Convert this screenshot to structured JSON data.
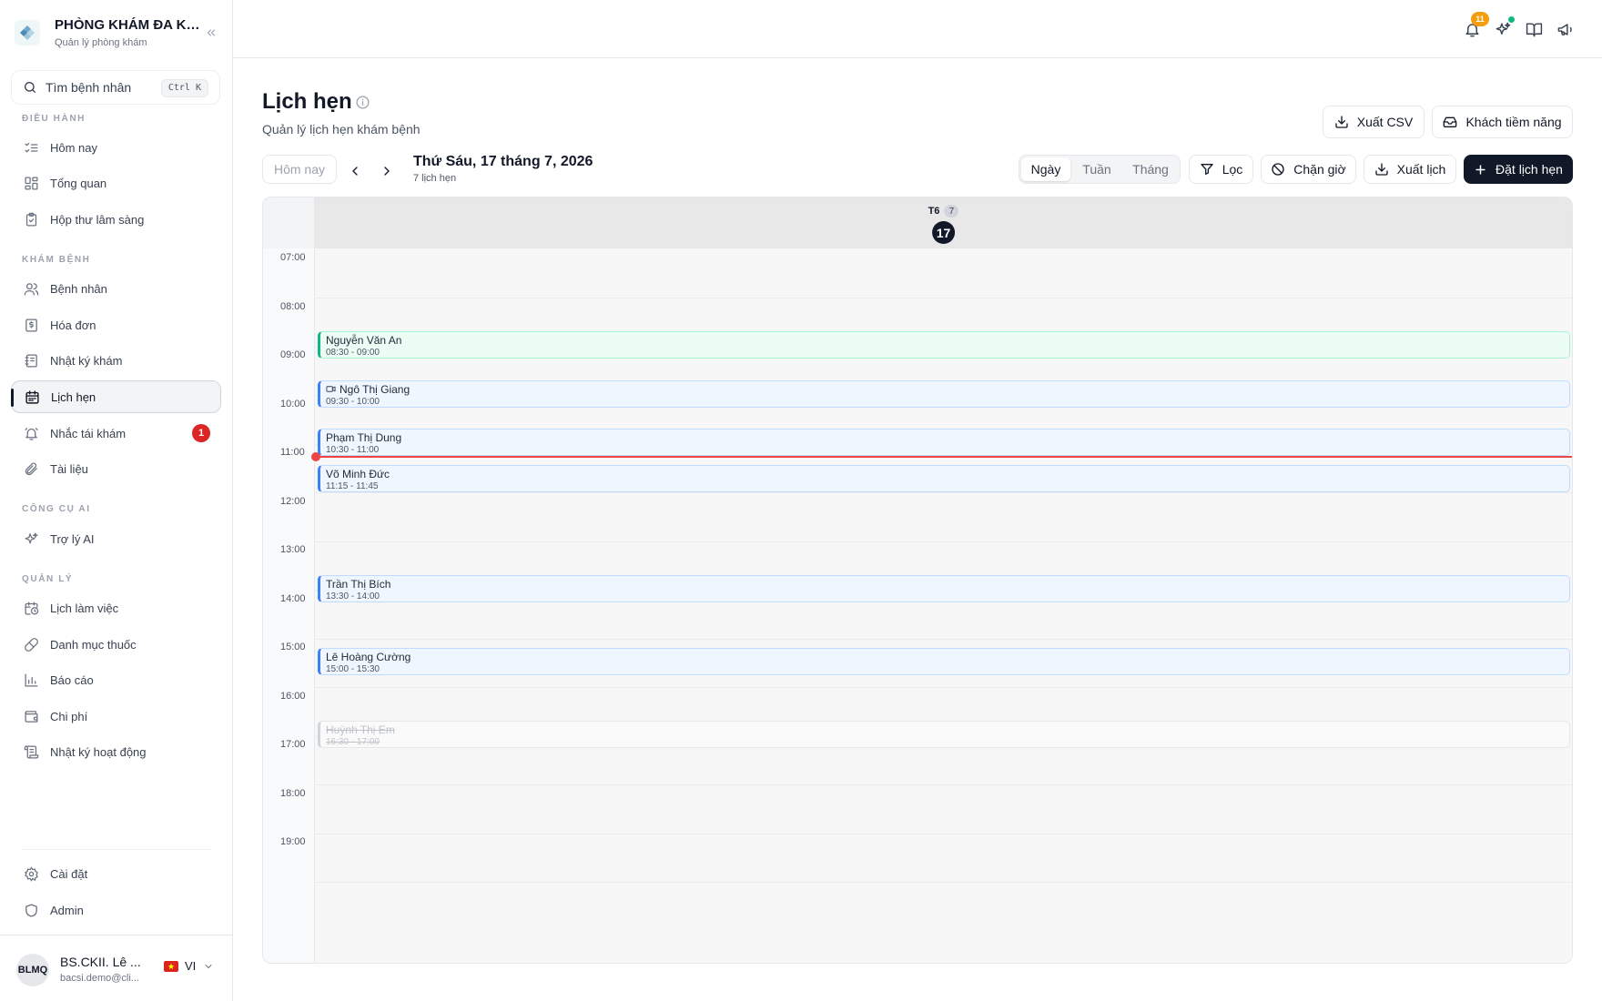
{
  "brand": {
    "title": "PHÒNG KHÁM ĐA KH...",
    "subtitle": "Quản lý phòng khám"
  },
  "search": {
    "placeholder": "Tìm bệnh nhân",
    "shortcut": "Ctrl K"
  },
  "sidebar": {
    "sections": [
      {
        "label": "ĐIỀU HÀNH",
        "items": [
          {
            "label": "Hôm nay",
            "icon": "list-check-icon"
          },
          {
            "label": "Tổng quan",
            "icon": "layout-grid-icon"
          },
          {
            "label": "Hộp thư lâm sàng",
            "icon": "clipboard-check-icon"
          }
        ]
      },
      {
        "label": "KHÁM BỆNH",
        "items": [
          {
            "label": "Bệnh nhân",
            "icon": "users-icon"
          },
          {
            "label": "Hóa đơn",
            "icon": "receipt-dollar-icon"
          },
          {
            "label": "Nhật ký khám",
            "icon": "notebook-icon"
          },
          {
            "label": "Lịch hẹn",
            "icon": "calendar-icon",
            "active": true
          },
          {
            "label": "Nhắc tái khám",
            "icon": "bell-ring-icon",
            "badge": "1"
          },
          {
            "label": "Tài liệu",
            "icon": "paperclip-icon"
          }
        ]
      },
      {
        "label": "CÔNG CỤ AI",
        "items": [
          {
            "label": "Trợ lý AI",
            "icon": "sparkles-icon"
          }
        ]
      },
      {
        "label": "QUẢN LÝ",
        "items": [
          {
            "label": "Lịch làm việc",
            "icon": "calendar-clock-icon"
          },
          {
            "label": "Danh mục thuốc",
            "icon": "pill-icon"
          },
          {
            "label": "Báo cáo",
            "icon": "bar-chart-icon"
          },
          {
            "label": "Chi phí",
            "icon": "wallet-icon"
          },
          {
            "label": "Nhật ký hoạt động",
            "icon": "scroll-text-icon"
          }
        ]
      }
    ],
    "bottom_items": [
      {
        "label": "Cài đặt",
        "icon": "gear-icon"
      },
      {
        "label": "Admin",
        "icon": "shield-icon"
      }
    ]
  },
  "user": {
    "initials": "BLMQ",
    "name": "BS.CKII. Lê ...",
    "email": "bacsi.demo@cli...",
    "language": "VI"
  },
  "topbar": {
    "notification_count": "11",
    "icons": [
      "bell-icon",
      "sparkles-icon",
      "book-open-icon",
      "megaphone-icon"
    ]
  },
  "header": {
    "title": "Lịch hẹn",
    "subtitle": "Quản lý lịch hẹn khám bệnh",
    "export_csv": "Xuất CSV",
    "leads": "Khách tiềm năng"
  },
  "toolbar": {
    "today": "Hôm nay",
    "date_title": "Thứ Sáu, 17 tháng 7, 2026",
    "appointment_count": "7 lịch hẹn",
    "views": [
      "Ngày",
      "Tuần",
      "Tháng"
    ],
    "active_view": "Ngày",
    "filter": "Lọc",
    "block_time": "Chặn giờ",
    "export_calendar": "Xuất lịch",
    "new_appointment": "Đặt lịch hẹn"
  },
  "calendar": {
    "day": {
      "name": "T6",
      "count": "7",
      "date": "17"
    },
    "hours": [
      "07:00",
      "08:00",
      "09:00",
      "10:00",
      "11:00",
      "12:00",
      "13:00",
      "14:00",
      "15:00",
      "16:00",
      "17:00",
      "18:00",
      "19:00"
    ],
    "now_time": "11:05",
    "appointments": [
      {
        "name": "Nguyễn Văn An",
        "time": "08:30 - 09:00",
        "start": "08:30",
        "status": "confirmed",
        "color": "#10b981"
      },
      {
        "name": "Ngô Thị Giang",
        "time": "09:30 - 10:00",
        "start": "09:30",
        "status": "scheduled",
        "video": true,
        "color": "#3b82f6"
      },
      {
        "name": "Phạm Thị Dung",
        "time": "10:30 - 11:00",
        "start": "10:30",
        "status": "scheduled",
        "color": "#3b82f6"
      },
      {
        "name": "Võ Minh Đức",
        "time": "11:15 - 11:45",
        "start": "11:15",
        "status": "scheduled",
        "color": "#3b82f6"
      },
      {
        "name": "Trần Thị Bích",
        "time": "13:30 - 14:00",
        "start": "13:30",
        "status": "scheduled",
        "color": "#3b82f6"
      },
      {
        "name": "Lê Hoàng Cường",
        "time": "15:00 - 15:30",
        "start": "15:00",
        "status": "scheduled",
        "color": "#3b82f6"
      },
      {
        "name": "Huỳnh Thị Em",
        "time": "16:30 - 17:00",
        "start": "16:30",
        "status": "cancelled",
        "color": "#d1d5db"
      }
    ]
  },
  "colors": {
    "primary": "#111827",
    "now_indicator": "#ef4444",
    "badge_red": "#dc2626",
    "notification_badge": "#f59e0b"
  }
}
